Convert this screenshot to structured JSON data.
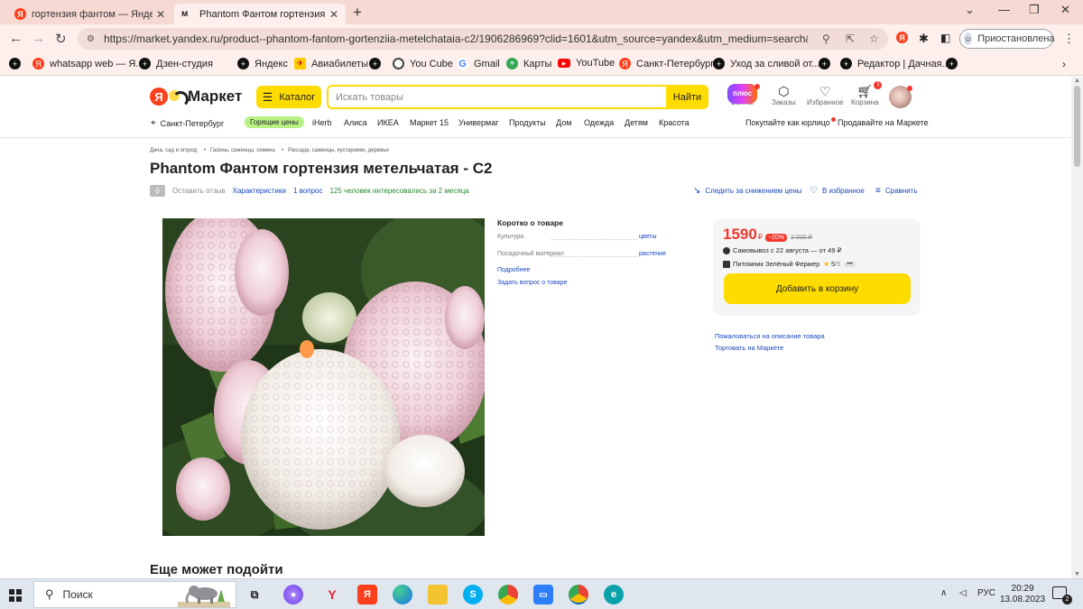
{
  "browser": {
    "tabs": [
      {
        "title": "гортензия фантом — Яндекс: на",
        "icon": "yandex-icon",
        "active": false
      },
      {
        "title": "Phantom Фантом гортензия мет",
        "icon": "market-icon",
        "active": true
      }
    ],
    "url": "https://market.yandex.ru/product--phantom-fantom-gortenziia-metelchataia-c2/1906286969?clid=1601&utm_source=yandex&utm_medium=search&utm_camp...",
    "profile_status": "Приостановлена",
    "bookmarks": [
      {
        "label": "whatsapp web — Я...",
        "icon": "yandex-icon"
      },
      {
        "label": "Дзен-студия",
        "icon": "plus-circle-icon"
      },
      {
        "label": "Яндекс",
        "icon": "plus-circle-icon"
      },
      {
        "label": "Авиабилеты",
        "icon": "aviatickets-icon"
      },
      {
        "label": "You Cube",
        "icon": "chrome-icon"
      },
      {
        "label": "Gmail",
        "icon": "google-icon"
      },
      {
        "label": "Карты",
        "icon": "maps-icon"
      },
      {
        "label": "YouTube",
        "icon": "youtube-icon"
      },
      {
        "label": "Санкт-Петербург",
        "icon": "yandex-icon"
      },
      {
        "label": "Уход за сливой от...",
        "icon": "plus-circle-icon"
      },
      {
        "label": "Редактор | Дачная...",
        "icon": "plus-circle-icon"
      }
    ]
  },
  "market": {
    "logo_text": "Маркет",
    "catalog_label": "Каталог",
    "search_placeholder": "Искать товары",
    "search_button": "Найти",
    "header_icons": [
      {
        "label": "Баллы",
        "icon": "plus-badge",
        "text": "плюс"
      },
      {
        "label": "Заказы",
        "icon": "box-icon"
      },
      {
        "label": "Избранное",
        "icon": "heart-icon"
      },
      {
        "label": "Корзина",
        "icon": "cart-icon",
        "badge": "1"
      }
    ],
    "location": "Санкт-Петербург",
    "subnav": [
      "Горящие цены",
      "iHerb",
      "Алиса",
      "ИКЕА",
      "Маркет 15",
      "Универмаг",
      "Продукты",
      "Дом",
      "Одежда",
      "Детям",
      "Красота"
    ],
    "subnav_right": [
      "Покупайте как юрлицо",
      "Продавайте на Маркете"
    ]
  },
  "product": {
    "breadcrumbs": [
      "Дача, сад и огород",
      "Газоны, саженцы, семена",
      "Рассада, саженцы, кустарники, деревья"
    ],
    "title": "Phantom Фантом гортензия метельчатая - С2",
    "rating": "0",
    "leave_review": "Оставить отзыв",
    "characteristics": "Характеристики",
    "questions": "1 вопрос",
    "interest": "125 человек интересовались за 2 месяца",
    "actions": [
      "Следить за снижением цены",
      "В избранное",
      "Сравнить"
    ],
    "short_title": "Коротко о товаре",
    "props": [
      {
        "key": "Культура",
        "value": "цветы"
      },
      {
        "key": "Посадочный материал",
        "value": "растение"
      }
    ],
    "more_link": "Подробнее",
    "ask_link": "Задать вопрос о товаре",
    "price": "1590",
    "currency": "₽",
    "discount": "−20%",
    "old_price": "2 000 ₽",
    "delivery": "Самовывоз с 22 августа — от 49 ₽",
    "seller": "Питомник Зелёный Фермер",
    "seller_rating": "5",
    "seller_rating_max": "/5",
    "add_to_cart": "Добавить в корзину",
    "side_links": [
      "Пожаловаться на описание товара",
      "Торговать на Маркете"
    ],
    "more_title": "Еще может подойти"
  },
  "taskbar": {
    "search_label": "Поиск",
    "lang": "РУС",
    "time": "20:29",
    "date": "13.08.2023",
    "notifications": "2"
  },
  "colors": {
    "yandex_red": "#fc3f1d",
    "market_yellow": "#ffdc00",
    "price_red": "#f0382f",
    "link_blue": "#1a47b8",
    "tab_bar": "#f6d9d3"
  }
}
